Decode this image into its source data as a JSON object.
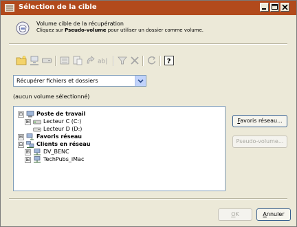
{
  "window": {
    "title": "Sélection de la cible",
    "controls": [
      "minimize",
      "maximize",
      "close"
    ]
  },
  "header": {
    "line1": "Volume cible de la récupération",
    "line2_before": "Cliquez sur ",
    "line2_bold": "Pseudo-volume",
    "line2_after": " pour utiliser un dossier comme volume.",
    "icon": "bag-icon"
  },
  "toolbar": {
    "buttons": [
      {
        "name": "new-folder",
        "icon": "folder-icon"
      },
      {
        "name": "network",
        "icon": "network-icon"
      },
      {
        "name": "drive",
        "icon": "drive-icon"
      },
      {
        "name": "view",
        "icon": "view-icon"
      },
      {
        "name": "properties",
        "icon": "properties-icon"
      },
      {
        "name": "connect",
        "icon": "connect-icon"
      },
      {
        "name": "rename",
        "icon": "rename-icon",
        "text": "ab|"
      },
      {
        "name": "filter",
        "icon": "filter-icon"
      },
      {
        "name": "delete",
        "icon": "delete-icon"
      },
      {
        "name": "refresh",
        "icon": "refresh-icon"
      },
      {
        "name": "help",
        "icon": "help-icon"
      }
    ]
  },
  "mode_select": {
    "value": "Récupérer fichiers et dossiers"
  },
  "status_text": "(aucun volume sélectionné)",
  "tree": {
    "nodes": [
      {
        "label": "Poste de travail",
        "expander": "⊟",
        "bold": true,
        "icon": "computer-icon"
      },
      {
        "label": "Lecteur C (C:)",
        "expander": "⊞",
        "bold": false,
        "icon": "harddrive-icon"
      },
      {
        "label": "Lecteur D (D:)",
        "expander": "",
        "bold": false,
        "icon": "drive-icon"
      },
      {
        "label": "Favoris réseau",
        "expander": "⊞",
        "bold": true,
        "icon": "network-favorites-icon"
      },
      {
        "label": "Clients en réseau",
        "expander": "⊟",
        "bold": true,
        "icon": "network-clients-icon"
      },
      {
        "label": "DV_BENC",
        "expander": "⊞",
        "bold": false,
        "icon": "client-computer-icon"
      },
      {
        "label": "TechPubs_iMac",
        "expander": "⊞",
        "bold": false,
        "icon": "client-computer-icon"
      }
    ]
  },
  "side_buttons": {
    "favoris_reseau": {
      "mnemonic": "F",
      "rest": "avoris réseau..."
    },
    "pseudo_volume": {
      "mnemonic": "",
      "rest": "Pseudo-volume..."
    }
  },
  "footer": {
    "ok": {
      "mnemonic": "O",
      "rest": "K"
    },
    "annuler": {
      "mnemonic": "A",
      "rest": "nnuler"
    }
  },
  "colors": {
    "titlebar": "#b24a1c",
    "dialog_bg": "#ece9d8",
    "tree_border": "#7f9db9"
  }
}
